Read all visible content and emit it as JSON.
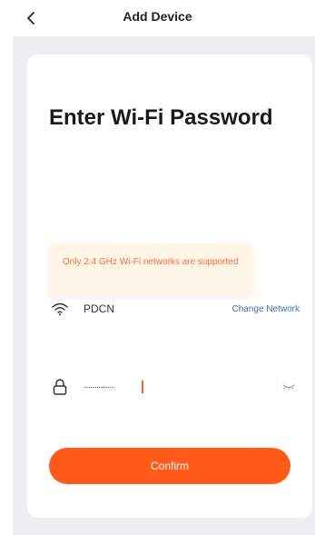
{
  "header": {
    "title": "Add Device",
    "back_icon": "chevron-left-icon"
  },
  "card": {
    "heading": "Enter Wi-Fi Password",
    "tip": "Only 2.4 GHz Wi-Fi networks are supported",
    "wifi": {
      "icon": "wifi-icon",
      "ssid": "PDCN",
      "change_label": "Change Network"
    },
    "password": {
      "icon": "lock-icon",
      "masked_value": "··············",
      "visibility_icon": "eye-closed-icon"
    },
    "confirm_label": "Confirm"
  },
  "colors": {
    "accent": "#ff5a1a",
    "tip_text": "#ff6a2a",
    "tip_bg": "#fff6e8",
    "link": "#3f72b8",
    "page_bg": "#eeeef0"
  }
}
